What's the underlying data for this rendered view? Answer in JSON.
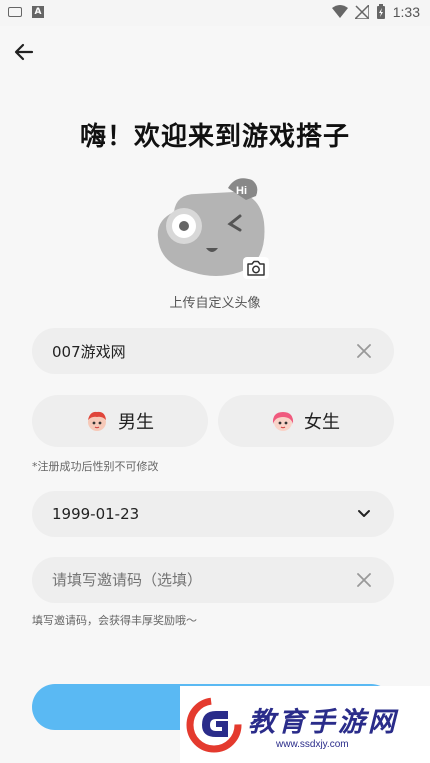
{
  "status_bar": {
    "time": "1:33",
    "a_badge": "A"
  },
  "header": {
    "back_icon": "arrow-left-icon"
  },
  "title": "嗨！欢迎来到游戏搭子",
  "avatar": {
    "upload_label": "上传自定义头像",
    "camera_icon": "camera-icon"
  },
  "nickname": {
    "value": "007游戏网"
  },
  "gender": {
    "male_label": "男生",
    "female_label": "女生"
  },
  "gender_hint": "*注册成功后性别不可修改",
  "birthday": {
    "value": "1999-01-23"
  },
  "invite": {
    "placeholder": "请填写邀请码（选填）"
  },
  "invite_hint": "填写邀请码，会获得丰厚奖励哦～",
  "watermark": {
    "text": "教育手游网",
    "url": "www.ssdxjy.com"
  },
  "colors": {
    "accent": "#5ab9f3",
    "field_bg": "#eeeeee",
    "watermark": "#2a2c8a"
  }
}
